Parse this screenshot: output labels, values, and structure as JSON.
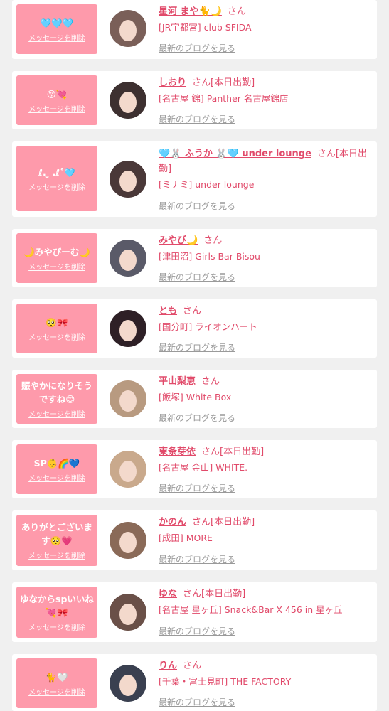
{
  "delete_label": "メッセージを削除",
  "blog_label": "最新のブログを見る",
  "colors": {
    "accent": "#e14a6a",
    "bubble": "#fe9aab",
    "muted": "#9a9a9a",
    "background": "#f0f0f0"
  },
  "items": [
    {
      "message": "🩵🩵🩵",
      "name": "星河 まや🐈🌙",
      "suffix": "さん",
      "store": "[JR宇都宮] club SFIDA"
    },
    {
      "message": "😚💘",
      "name": "しおり",
      "suffix": "さん[本日出勤]",
      "store": "[名古屋 錦] Panther 名古屋錦店"
    },
    {
      "message": "ℓ. ̫ .ℓ˚🩵",
      "name": "🩵🐰 ふうか 🐰🩵 under lounge",
      "suffix": "さん[本日出勤]",
      "store": "[ミナミ] under lounge"
    },
    {
      "message": "🌙みやびーむ🌙",
      "name": "みやび🌙",
      "suffix": "さん",
      "store": "[津田沼] Girls Bar Bisou"
    },
    {
      "message": "🥺🎀",
      "name": "とも",
      "suffix": "さん",
      "store": "[国分町] ライオンハート"
    },
    {
      "message": "賑やかになりそうですね😊",
      "name": "平山梨恵",
      "suffix": "さん",
      "store": "[飯塚] White Box"
    },
    {
      "message": "SP👶🌈💙",
      "name": "東条芽依",
      "suffix": "さん[本日出勤]",
      "store": "[名古屋 金山] WHITE."
    },
    {
      "message": "ありがとございます🥺💗",
      "name": "かのん",
      "suffix": "さん[本日出勤]",
      "store": "[成田] MORE"
    },
    {
      "message": "ゆなからspいいね💘🎀",
      "name": "ゆな",
      "suffix": "さん[本日出勤]",
      "store": "[名古屋 星ヶ丘] Snack&Bar X 456 in 星ヶ丘"
    },
    {
      "message": "🐈🤍",
      "name": "りん",
      "suffix": "さん",
      "store": "[千葉・富士見町] THE FACTORY"
    }
  ]
}
